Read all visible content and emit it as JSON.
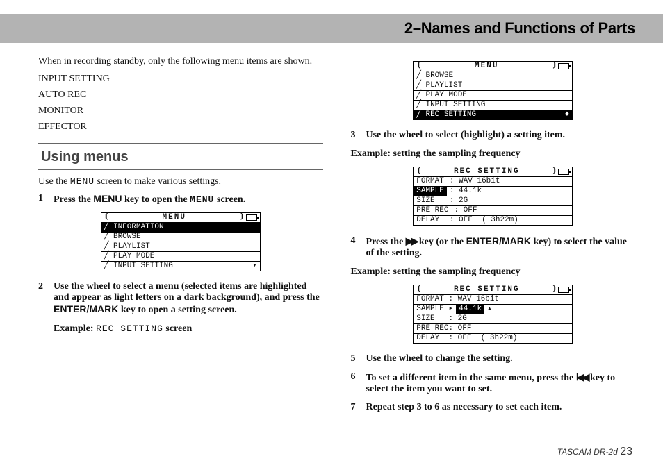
{
  "header": {
    "title": "2–Names and Functions of Parts"
  },
  "left": {
    "intro": "When in recording standby, only the following menu items are shown.",
    "items": [
      "INPUT SETTING",
      "AUTO REC",
      "MONITOR",
      "EFFECTOR"
    ],
    "sectionTitle": "Using menus",
    "useMenuPre": "Use the ",
    "useMenuScreen": "MENU",
    "useMenuPost": " screen to make various settings.",
    "step1": {
      "num": "1",
      "pre": "Press the ",
      "key": "MENU",
      "mid": " key to open the ",
      "scr": "MENU",
      "post": " screen."
    },
    "lcd1": {
      "title": "MENU",
      "rows": [
        {
          "text": "INFORMATION",
          "inv": true
        },
        {
          "text": "BROWSE",
          "inv": false
        },
        {
          "text": "PLAYLIST",
          "inv": false
        },
        {
          "text": "PLAY MODE",
          "inv": false
        },
        {
          "text": "INPUT SETTING",
          "inv": false,
          "arrow": "▾"
        }
      ]
    },
    "step2": {
      "num": "2",
      "pre": "Use the wheel to select a menu (selected items are highlighted and appear as light letters on a dark background), and press the ",
      "key": "ENTER/MARK",
      "post": " key to open a setting screen."
    },
    "example2Pre": "Example: ",
    "example2Scr": "REC SETTING",
    "example2Post": " screen"
  },
  "right": {
    "lcdMenu": {
      "title": "MENU",
      "rows": [
        {
          "text": "BROWSE",
          "inv": false
        },
        {
          "text": "PLAYLIST",
          "inv": false
        },
        {
          "text": "PLAY MODE",
          "inv": false
        },
        {
          "text": "INPUT SETTING",
          "inv": false
        },
        {
          "text": "REC SETTING",
          "inv": true,
          "arrow": "♦"
        }
      ]
    },
    "step3": {
      "num": "3",
      "text": "Use the wheel to select (highlight) a setting item."
    },
    "example3": "Example: setting the sampling frequency",
    "lcdRec1": {
      "title": "REC SETTING",
      "rows": [
        {
          "k": "FORMAT",
          "kinv": false,
          "v": ": WAV 16bit"
        },
        {
          "k": "SAMPLE",
          "kinv": true,
          "v": ": 44.1k"
        },
        {
          "k": "SIZE  ",
          "kinv": false,
          "v": ": 2G"
        },
        {
          "k": "PRE REC",
          "kinv": false,
          "v": ": OFF"
        },
        {
          "k": "DELAY ",
          "kinv": false,
          "v": ": OFF  ( 3h22m)"
        }
      ]
    },
    "step4": {
      "num": "4",
      "pre": "Press the ",
      "icon": "▶▶",
      "mid": " key (or the ",
      "key": "ENTER/MARK",
      "post": " key) to select the value of the setting."
    },
    "example4": "Example: setting the sampling frequency",
    "lcdRec2": {
      "title": "REC SETTING",
      "rows": [
        {
          "text": "FORMAT : WAV 16bit"
        },
        {
          "text": "SAMPLE ▸",
          "valInv": "44.1k",
          "tail": "▴"
        },
        {
          "text": "SIZE   : 2G"
        },
        {
          "text": "PRE REC: OFF"
        },
        {
          "text": "DELAY  : OFF  ( 3h22m)"
        }
      ]
    },
    "step5": {
      "num": "5",
      "text": "Use the wheel to change the setting."
    },
    "step6": {
      "num": "6",
      "pre": "To set a different item in the same menu, press the ",
      "icon": "Ⅰ◀◀",
      "post": " key to select the item you want to set."
    },
    "step7": {
      "num": "7",
      "text": "Repeat step 3 to 6 as necessary to set each item."
    }
  },
  "footer": {
    "model": "TASCAM  DR-2d ",
    "page": "23"
  }
}
